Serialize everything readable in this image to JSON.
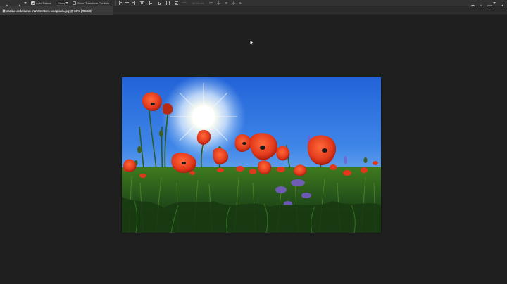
{
  "options_bar": {
    "auto_select_label": "Auto-Select:",
    "auto_select_checked": true,
    "auto_select_target": "Group",
    "show_transform_label": "Show Transform Controls",
    "show_transform_checked": false,
    "mode_3d_label": "3D Mode:"
  },
  "document": {
    "tab_title": "corina-ardeleanu-vWsCwr0zrs-unsplash.jpg @ 50% (RGB/8)"
  },
  "icons": {
    "left": [
      "home-icon",
      "move-tool-icon"
    ],
    "right": [
      "search-icon",
      "workspace-icon",
      "share-icon"
    ]
  },
  "colors": {
    "app_bg": "#1e1e1e",
    "options_bar_bg": "#323232",
    "tab_active_bg": "#3a3a3a",
    "sky_top": "#1e62d6",
    "poppy_red": "#e23a1c"
  }
}
